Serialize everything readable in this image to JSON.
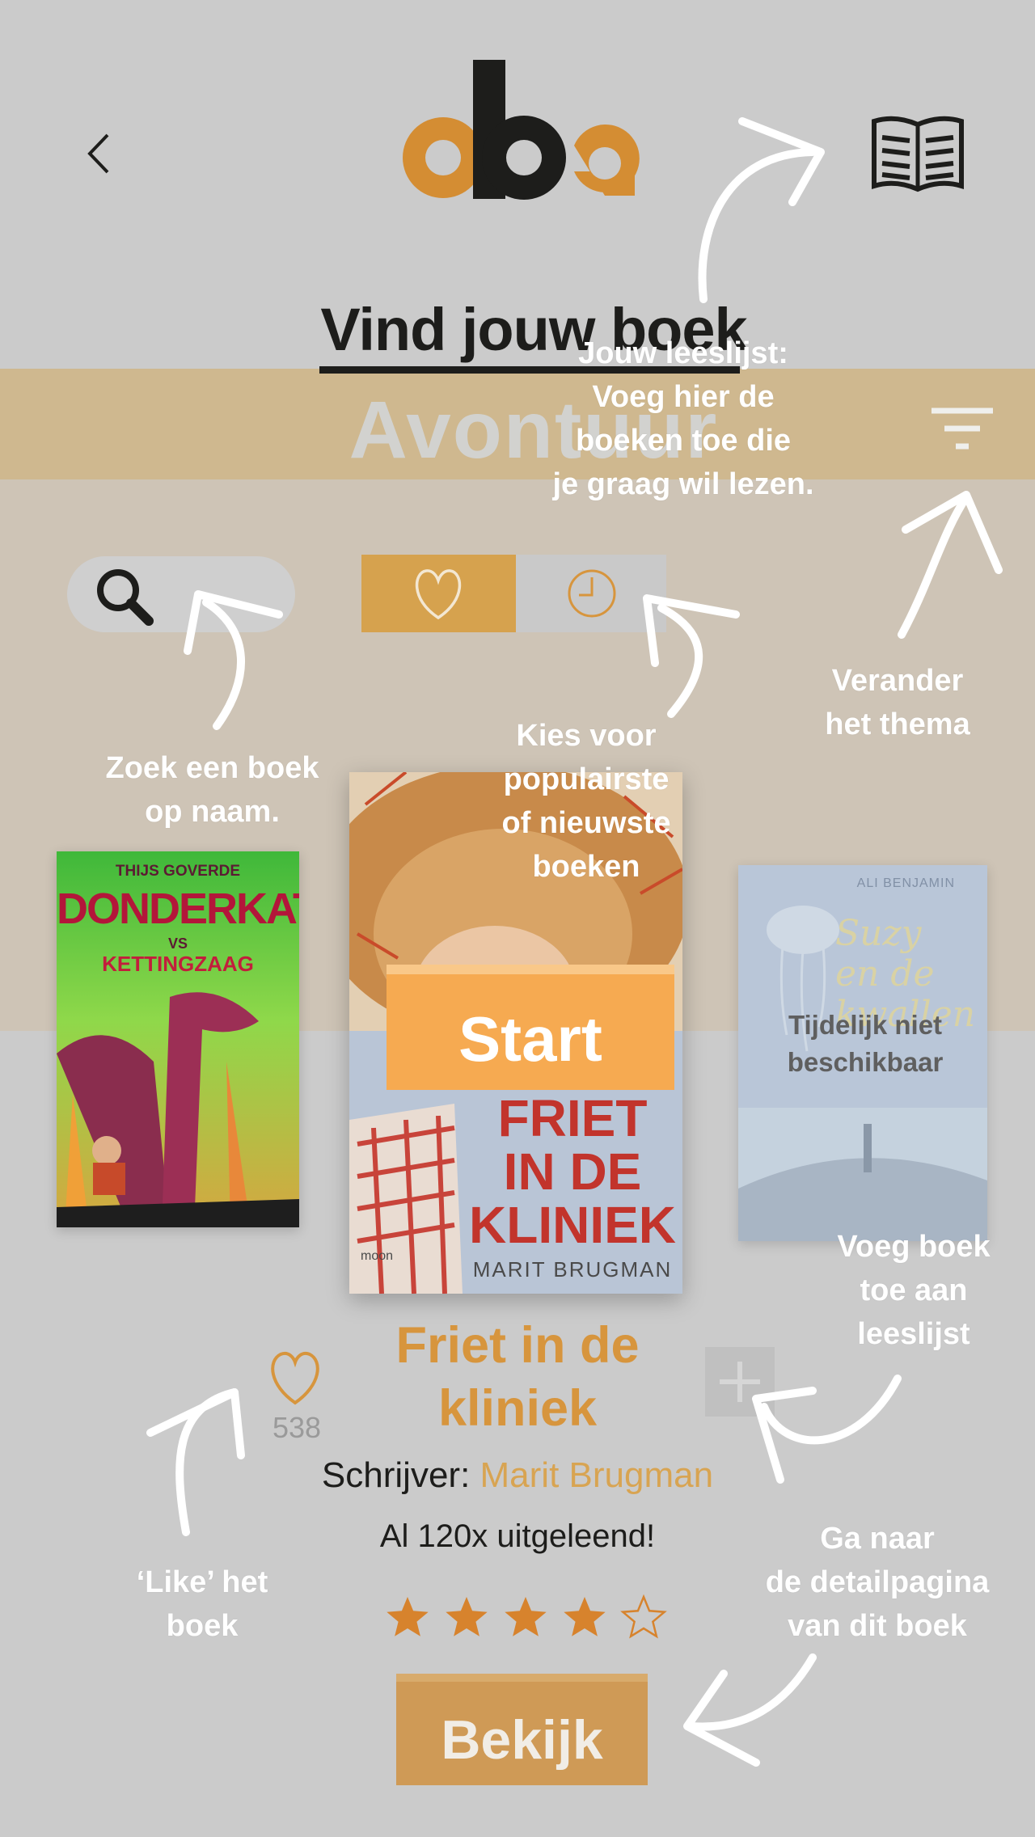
{
  "header": {
    "back_icon": "chevron-left-icon",
    "logo_text": "oba",
    "reading_list_icon": "open-book-icon",
    "title": "Vind jouw boek"
  },
  "theme": {
    "label": "Avontuur",
    "filter_icon": "filter-icon"
  },
  "controls": {
    "search_icon": "search-icon",
    "search_placeholder": "",
    "popular_icon": "heart-icon",
    "new_icon": "clock-icon",
    "active": "popular"
  },
  "books": {
    "left": {
      "author": "THIJS GOVERDE",
      "title_main": "DONDERKAT",
      "title_vs": "VS",
      "title_sub": "KETTINGZAAG"
    },
    "center": {
      "title_lines": [
        "FRIET",
        "IN DE",
        "KLINIEK"
      ],
      "author": "MARIT BRUGMAN",
      "publisher": "moon",
      "start_label": "Start"
    },
    "right": {
      "author": "ALI BENJAMIN",
      "title_lines": [
        "Suzy",
        "en de",
        "kwallen"
      ],
      "unavailable_label": "Tijdelijk niet beschikbaar"
    }
  },
  "selected": {
    "title": "Friet in de kliniek",
    "author_prefix": "Schrijver:",
    "author": "Marit Brugman",
    "loans": "Al 120x uitgeleend!",
    "likes": "538",
    "rating": 4,
    "rating_max": 5,
    "view_label": "Bekijk"
  },
  "annotations": {
    "reading_list": "Jouw leeslijst: Voeg hier de boeken toe die je graag wil lezen.",
    "reading_list_lines": [
      "Jouw leeslijst:",
      "Voeg hier de",
      "boeken toe die",
      "je graag wil lezen."
    ],
    "theme_lines": [
      "Verander",
      "het thema"
    ],
    "search_lines": [
      "Zoek een boek",
      "op naam."
    ],
    "sort_lines": [
      "Kies voor",
      "populairste",
      "of nieuwste",
      "boeken"
    ],
    "add_lines": [
      "Voeg boek",
      "toe aan",
      "leeslijst"
    ],
    "like_lines": [
      "‘Like’ het",
      "boek"
    ],
    "detail_lines": [
      "Ga naar",
      "de detailpagina",
      "van dit boek"
    ]
  },
  "colors": {
    "background": "#cbcbcb",
    "theme_band": "#cfb88f",
    "beige_band": "#cec4b6",
    "accent_orange": "#d7953d",
    "start_button": "#f6aa51",
    "dark": "#1d1d1b"
  }
}
